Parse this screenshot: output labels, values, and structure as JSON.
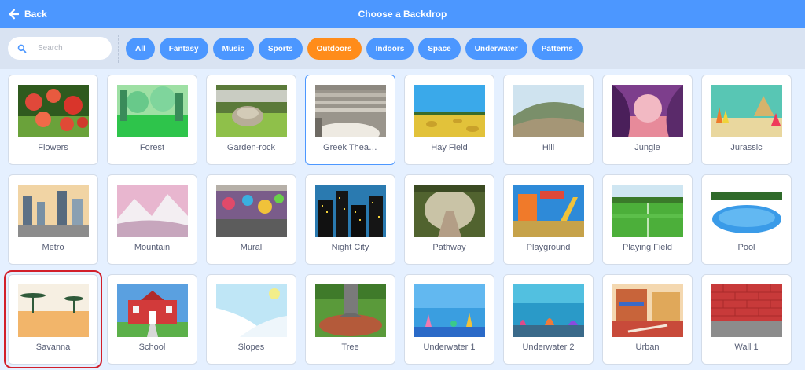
{
  "header": {
    "back_label": "Back",
    "title": "Choose a Backdrop"
  },
  "search": {
    "placeholder": "Search"
  },
  "categories": [
    {
      "label": "All",
      "active": false
    },
    {
      "label": "Fantasy",
      "active": false
    },
    {
      "label": "Music",
      "active": false
    },
    {
      "label": "Sports",
      "active": false
    },
    {
      "label": "Outdoors",
      "active": true
    },
    {
      "label": "Indoors",
      "active": false
    },
    {
      "label": "Space",
      "active": false
    },
    {
      "label": "Underwater",
      "active": false
    },
    {
      "label": "Patterns",
      "active": false
    }
  ],
  "backdrops": [
    {
      "label": "Flowers",
      "icon": "flowers-thumbnail"
    },
    {
      "label": "Forest",
      "icon": "forest-thumbnail"
    },
    {
      "label": "Garden-rock",
      "icon": "garden-rock-thumbnail"
    },
    {
      "label": "Greek Thea…",
      "icon": "greek-theater-thumbnail",
      "selected": true
    },
    {
      "label": "Hay Field",
      "icon": "hay-field-thumbnail"
    },
    {
      "label": "Hill",
      "icon": "hill-thumbnail"
    },
    {
      "label": "Jungle",
      "icon": "jungle-thumbnail"
    },
    {
      "label": "Jurassic",
      "icon": "jurassic-thumbnail"
    },
    {
      "label": "Metro",
      "icon": "metro-thumbnail"
    },
    {
      "label": "Mountain",
      "icon": "mountain-thumbnail"
    },
    {
      "label": "Mural",
      "icon": "mural-thumbnail"
    },
    {
      "label": "Night City",
      "icon": "night-city-thumbnail"
    },
    {
      "label": "Pathway",
      "icon": "pathway-thumbnail"
    },
    {
      "label": "Playground",
      "icon": "playground-thumbnail"
    },
    {
      "label": "Playing Field",
      "icon": "playing-field-thumbnail"
    },
    {
      "label": "Pool",
      "icon": "pool-thumbnail"
    },
    {
      "label": "Savanna",
      "icon": "savanna-thumbnail",
      "highlighted": true
    },
    {
      "label": "School",
      "icon": "school-thumbnail"
    },
    {
      "label": "Slopes",
      "icon": "slopes-thumbnail"
    },
    {
      "label": "Tree",
      "icon": "tree-thumbnail"
    },
    {
      "label": "Underwater 1",
      "icon": "underwater-1-thumbnail"
    },
    {
      "label": "Underwater 2",
      "icon": "underwater-2-thumbnail"
    },
    {
      "label": "Urban",
      "icon": "urban-thumbnail"
    },
    {
      "label": "Wall 1",
      "icon": "wall-1-thumbnail"
    }
  ],
  "colors": {
    "header": "#4c97ff",
    "filter_bar": "#d9e3f2",
    "background": "#e5f0ff",
    "chip": "#4c97ff",
    "chip_active": "#ff8c1a",
    "highlight_ring": "#d21f2a",
    "label_text": "#575e75"
  }
}
